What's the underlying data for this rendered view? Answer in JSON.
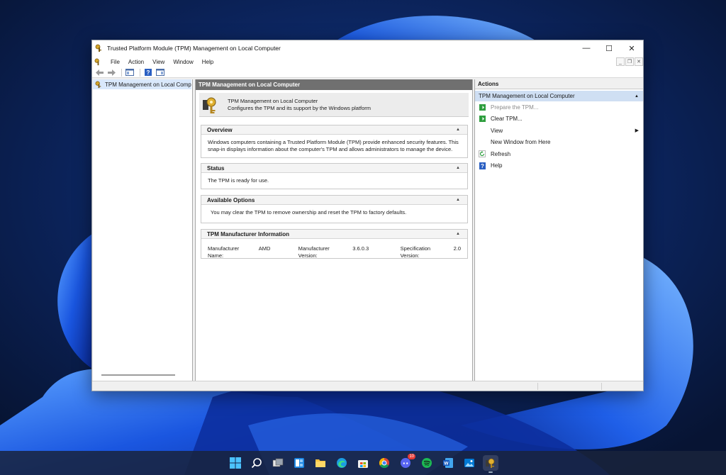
{
  "window": {
    "title": "Trusted Platform Module (TPM) Management on Local Computer",
    "controls": {
      "minimize": "—",
      "maximize": "☐",
      "close": "✕"
    }
  },
  "menu": {
    "items": [
      "File",
      "Action",
      "View",
      "Window",
      "Help"
    ],
    "mdi": {
      "minimize": "_",
      "restore": "❐",
      "close": "✕"
    }
  },
  "tree": {
    "root_label": "TPM Management on Local Comp"
  },
  "center": {
    "header": "TPM Management on Local Computer",
    "summary": {
      "title": "TPM Management on Local Computer",
      "subtitle": "Configures the TPM and its support by the Windows platform"
    },
    "sections": {
      "overview": {
        "title": "Overview",
        "text": "Windows computers containing a Trusted Platform Module (TPM) provide enhanced security features. This snap-in displays information about the computer's TPM and allows administrators to manage the device."
      },
      "status": {
        "title": "Status",
        "text": "The TPM is ready for use."
      },
      "options": {
        "title": "Available Options",
        "text": "You may clear the TPM to remove ownership and reset the TPM to factory defaults."
      },
      "manufacturer": {
        "title": "TPM Manufacturer Information",
        "name_label": "Manufacturer Name:",
        "name_value": "AMD",
        "version_label": "Manufacturer Version:",
        "version_value": "3.6.0.3",
        "spec_label": "Specification Version:",
        "spec_value": "2.0"
      }
    }
  },
  "actions": {
    "header": "Actions",
    "group": "TPM Management on Local Computer",
    "items": {
      "prepare": "Prepare the TPM...",
      "clear": "Clear TPM...",
      "view": "View",
      "new_window": "New Window from Here",
      "refresh": "Refresh",
      "help": "Help"
    }
  },
  "glyphs": {
    "collapse": "▲",
    "submenu": "▶"
  },
  "colors": {
    "accent_selected": "#cfdff3",
    "center_header": "#707070",
    "action_green": "#2e9e3e",
    "help_blue": "#2a5fc2"
  },
  "taskbar": {
    "icons": [
      "windows-start-icon",
      "search-icon",
      "task-view-icon",
      "widgets-icon",
      "file-explorer-icon",
      "edge-icon",
      "store-icon",
      "chrome-icon",
      "discord-icon",
      "spotify-icon",
      "word-icon",
      "photos-icon",
      "tpm-app-icon"
    ],
    "discord_badge": "10"
  }
}
